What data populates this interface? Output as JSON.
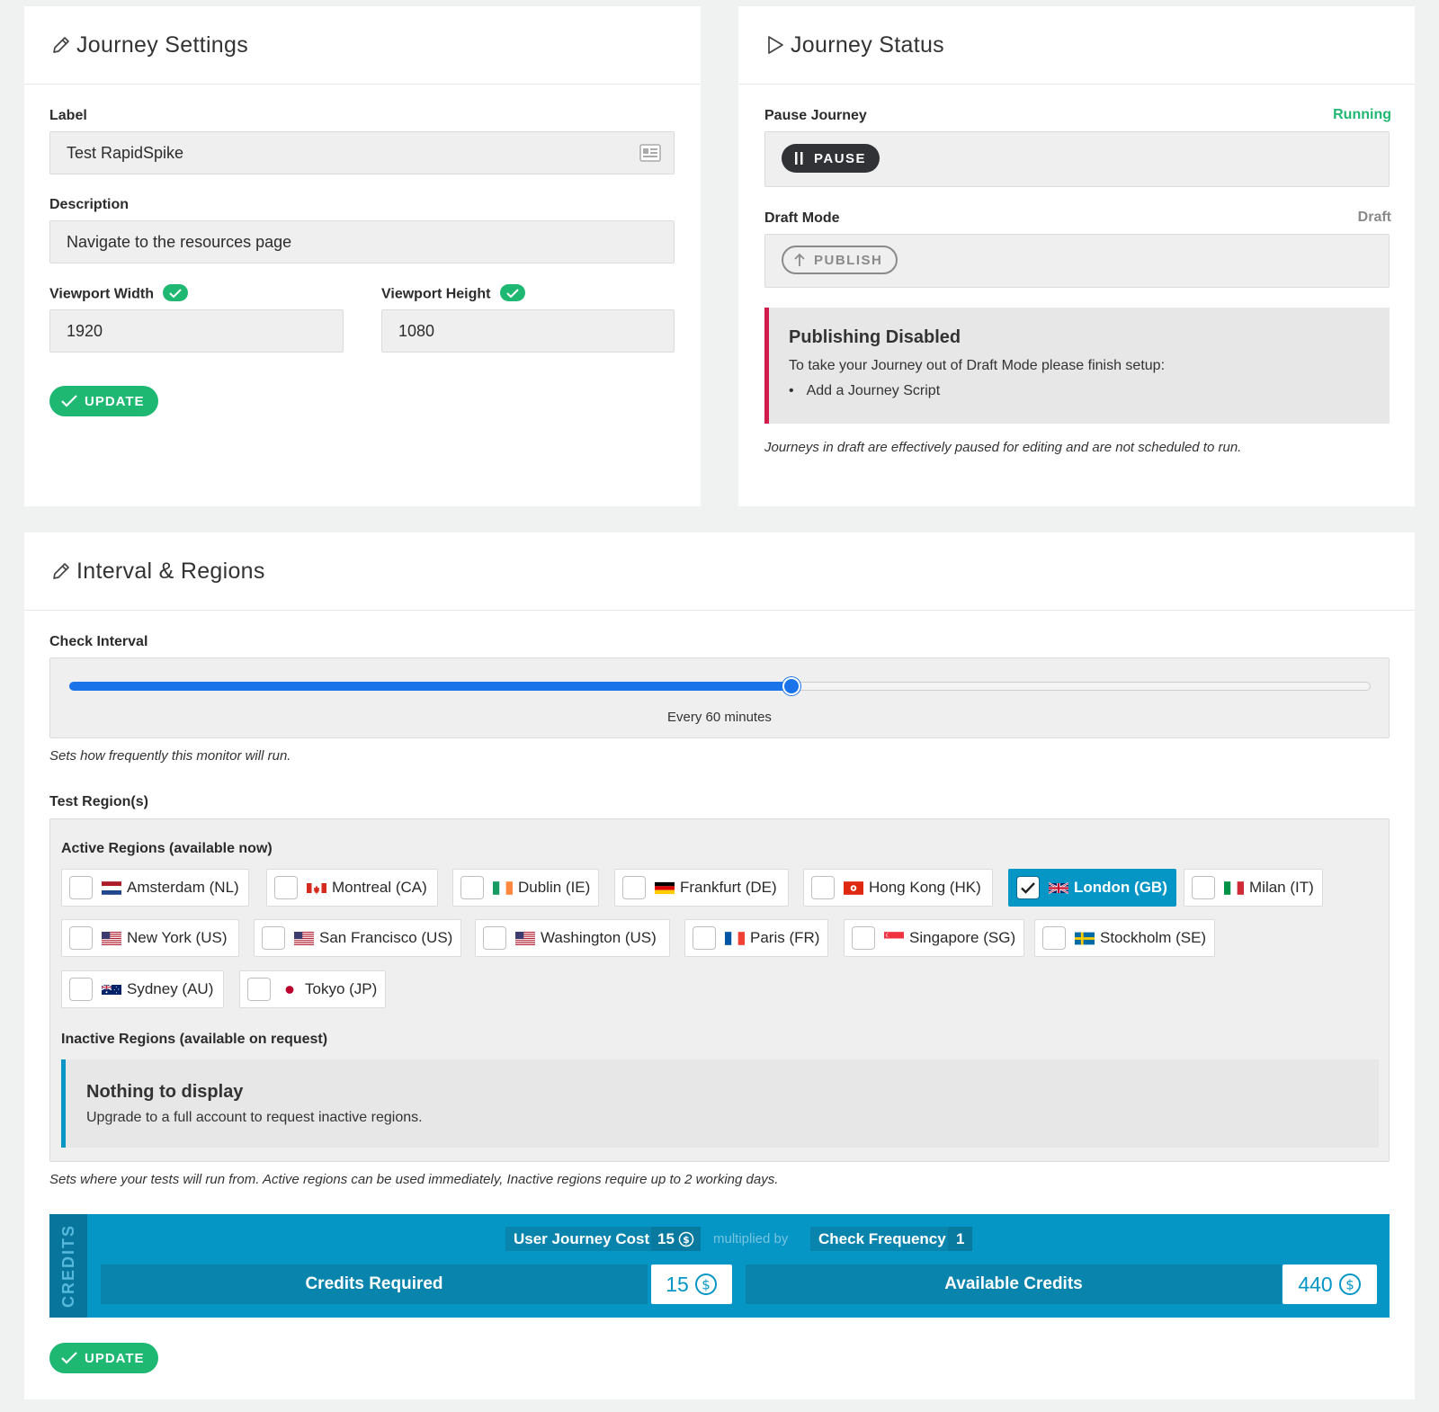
{
  "settings": {
    "title": "Journey Settings",
    "label_label": "Label",
    "label_value": "Test RapidSpike",
    "description_label": "Description",
    "description_value": "Navigate to the resources page",
    "vw_label": "Viewport Width",
    "vw_value": "1920",
    "vh_label": "Viewport Height",
    "vh_value": "1080",
    "update_label": "UPDATE"
  },
  "status": {
    "title": "Journey Status",
    "pause_label": "Pause Journey",
    "pause_state": "Running",
    "pause_button": "PAUSE",
    "draft_label": "Draft Mode",
    "draft_state": "Draft",
    "publish_button": "PUBLISH",
    "alert_title": "Publishing Disabled",
    "alert_text": "To take your Journey out of Draft Mode please finish setup:",
    "alert_item": "Add a Journey Script",
    "note": "Journeys in draft are effectively paused for editing and are not scheduled to run.",
    "colors": {
      "running": "#1fb872",
      "alert_border": "#d11b4a"
    }
  },
  "interval": {
    "title": "Interval & Regions",
    "check_label": "Check Interval",
    "slider_fraction": 0.555,
    "slider_text": "Every 60 minutes",
    "check_note": "Sets how frequently this monitor will run.",
    "regions_label": "Test Region(s)",
    "active_label": "Active Regions (available now)",
    "regions": [
      {
        "name": "Amsterdam (NL)",
        "flag": "nl",
        "checked": false
      },
      {
        "name": "Montreal (CA)",
        "flag": "ca",
        "checked": false
      },
      {
        "name": "Dublin (IE)",
        "flag": "ie",
        "checked": false
      },
      {
        "name": "Frankfurt (DE)",
        "flag": "de",
        "checked": false
      },
      {
        "name": "Hong Kong (HK)",
        "flag": "hk",
        "checked": false
      },
      {
        "name": "London (GB)",
        "flag": "gb",
        "checked": true
      },
      {
        "name": "Milan (IT)",
        "flag": "it",
        "checked": false
      },
      {
        "name": "New York (US)",
        "flag": "us",
        "checked": false
      },
      {
        "name": "San Francisco (US)",
        "flag": "us",
        "checked": false
      },
      {
        "name": "Washington (US)",
        "flag": "us",
        "checked": false
      },
      {
        "name": "Paris (FR)",
        "flag": "fr",
        "checked": false
      },
      {
        "name": "Singapore (SG)",
        "flag": "sg",
        "checked": false
      },
      {
        "name": "Stockholm (SE)",
        "flag": "se",
        "checked": false
      },
      {
        "name": "Sydney (AU)",
        "flag": "au",
        "checked": false
      },
      {
        "name": "Tokyo (JP)",
        "flag": "jp",
        "checked": false
      }
    ],
    "inactive_label": "Inactive Regions (available on request)",
    "empty_title": "Nothing to display",
    "empty_text": "Upgrade to a full account to request inactive regions.",
    "regions_note": "Sets where your tests will run from. Active regions can be used immediately, Inactive regions require up to 2 working days.",
    "credits": {
      "side_label": "CREDITS",
      "cost_label": "User Journey Cost",
      "cost_value": "15",
      "multiplied_by": "multiplied by",
      "freq_label": "Check Frequency",
      "freq_value": "1",
      "required_label": "Credits Required",
      "required_value": "15",
      "available_label": "Available Credits",
      "available_value": "440"
    },
    "update_label": "UPDATE",
    "colors": {
      "accent": "#0596c6",
      "green": "#1fb872"
    }
  }
}
